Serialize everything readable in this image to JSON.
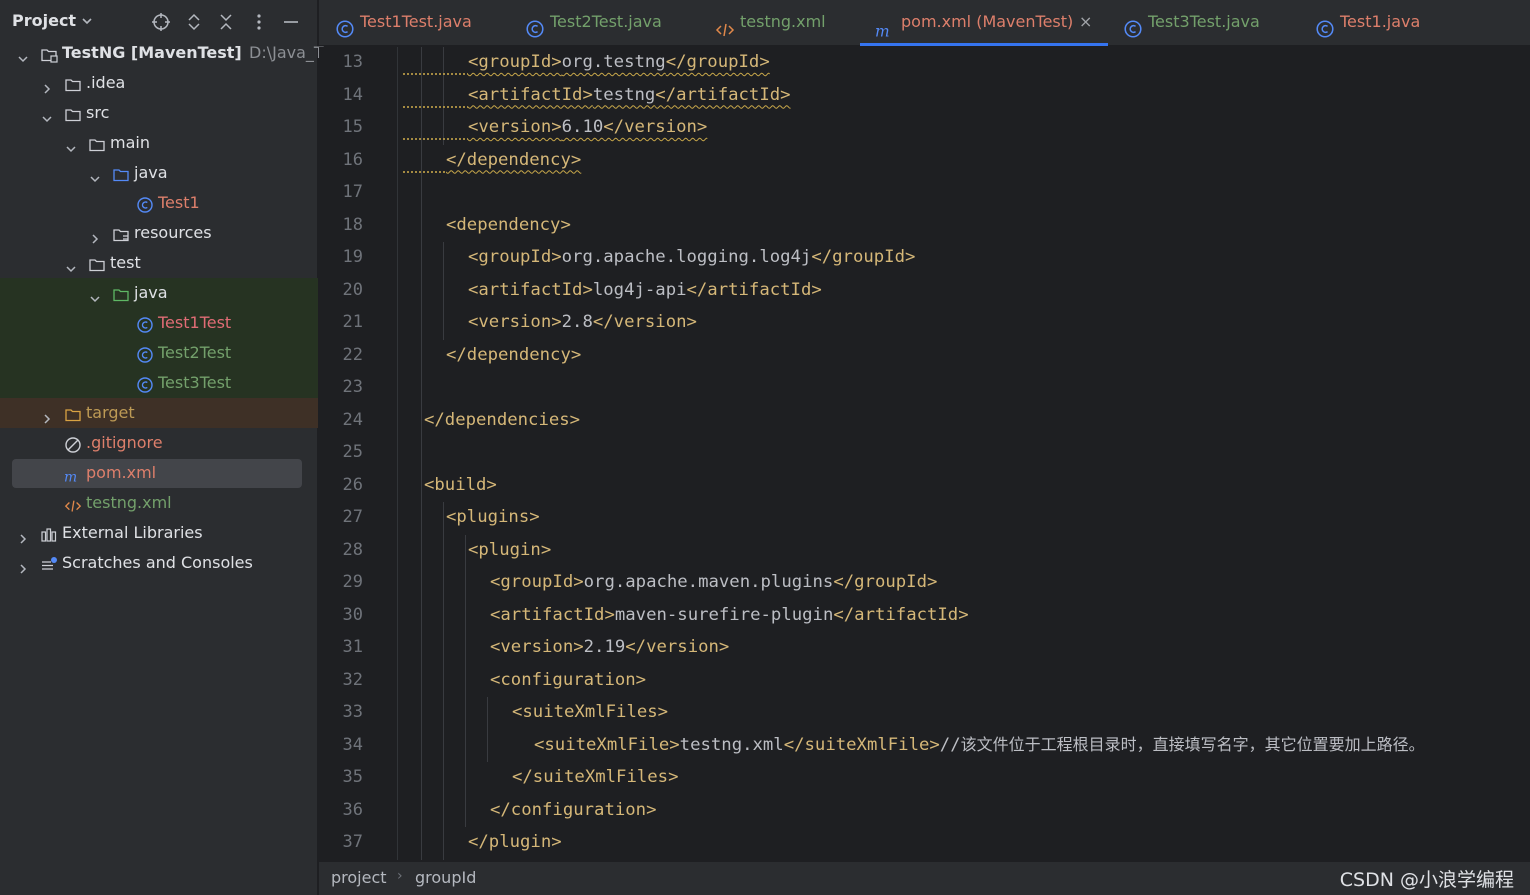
{
  "project_panel": {
    "title": "Project",
    "tree": [
      {
        "label": "TestNG [MavenTest]",
        "extra": "D:\\Java_T",
        "icon": "module-folder-icon",
        "expanded": true
      },
      {
        "label": ".idea",
        "icon": "folder-icon",
        "expanded": false
      },
      {
        "label": "src",
        "icon": "folder-icon",
        "expanded": true
      },
      {
        "label": "main",
        "icon": "folder-icon",
        "expanded": true
      },
      {
        "label": "java",
        "icon": "source-folder-icon",
        "expanded": true
      },
      {
        "label": "Test1",
        "icon": "java-class-icon"
      },
      {
        "label": "resources",
        "icon": "resources-folder-icon",
        "expanded": false
      },
      {
        "label": "test",
        "icon": "folder-icon",
        "expanded": true
      },
      {
        "label": "java",
        "icon": "test-folder-icon",
        "expanded": true
      },
      {
        "label": "Test1Test",
        "icon": "java-class-icon"
      },
      {
        "label": "Test2Test",
        "icon": "java-class-icon"
      },
      {
        "label": "Test3Test",
        "icon": "java-class-icon"
      },
      {
        "label": "target",
        "icon": "excluded-folder-icon",
        "expanded": false
      },
      {
        "label": ".gitignore",
        "icon": "ignore-file-icon"
      },
      {
        "label": "pom.xml",
        "icon": "maven-icon"
      },
      {
        "label": "testng.xml",
        "icon": "xml-icon"
      },
      {
        "label": "External Libraries",
        "icon": "libraries-icon",
        "expanded": false
      },
      {
        "label": "Scratches and Consoles",
        "icon": "scratches-icon",
        "expanded": false
      }
    ]
  },
  "tabs": [
    {
      "label": "Test1Test.java",
      "icon": "java-class-icon"
    },
    {
      "label": "Test2Test.java",
      "icon": "java-class-icon"
    },
    {
      "label": "testng.xml",
      "icon": "xml-icon"
    },
    {
      "label": "pom.xml (MavenTest)",
      "icon": "maven-icon",
      "active": true,
      "close": "×"
    },
    {
      "label": "Test3Test.java",
      "icon": "java-class-icon"
    },
    {
      "label": "Test1.java",
      "icon": "java-class-icon"
    }
  ],
  "editor": {
    "lines": [
      {
        "n": "13",
        "indent": 3,
        "parts": [
          [
            "tag",
            "<groupId>"
          ],
          [
            "txt",
            "org.testng"
          ],
          [
            "tag",
            "</groupId>"
          ]
        ],
        "warn": true
      },
      {
        "n": "14",
        "indent": 3,
        "parts": [
          [
            "tag",
            "<artifactId>"
          ],
          [
            "txt",
            "testng"
          ],
          [
            "tag",
            "</artifactId>"
          ]
        ],
        "warn": true
      },
      {
        "n": "15",
        "indent": 3,
        "parts": [
          [
            "tag",
            "<version>"
          ],
          [
            "txt",
            "6.10"
          ],
          [
            "tag",
            "</version>"
          ]
        ],
        "warn": true
      },
      {
        "n": "16",
        "indent": 2,
        "parts": [
          [
            "tag",
            "</dependency>"
          ]
        ],
        "warn": true
      },
      {
        "n": "17",
        "indent": 0,
        "parts": []
      },
      {
        "n": "18",
        "indent": 2,
        "parts": [
          [
            "tag",
            "<dependency>"
          ]
        ]
      },
      {
        "n": "19",
        "indent": 3,
        "parts": [
          [
            "tag",
            "<groupId>"
          ],
          [
            "txt",
            "org.apache.logging.log4j"
          ],
          [
            "tag",
            "</groupId>"
          ]
        ]
      },
      {
        "n": "20",
        "indent": 3,
        "parts": [
          [
            "tag",
            "<artifactId>"
          ],
          [
            "txt",
            "log4j-api"
          ],
          [
            "tag",
            "</artifactId>"
          ]
        ]
      },
      {
        "n": "21",
        "indent": 3,
        "parts": [
          [
            "tag",
            "<version>"
          ],
          [
            "txt",
            "2.8"
          ],
          [
            "tag",
            "</version>"
          ]
        ]
      },
      {
        "n": "22",
        "indent": 2,
        "parts": [
          [
            "tag",
            "</dependency>"
          ]
        ]
      },
      {
        "n": "23",
        "indent": 0,
        "parts": []
      },
      {
        "n": "24",
        "indent": 1,
        "parts": [
          [
            "tag",
            "</dependencies>"
          ]
        ]
      },
      {
        "n": "25",
        "indent": 0,
        "parts": []
      },
      {
        "n": "26",
        "indent": 1,
        "parts": [
          [
            "tag",
            "<build>"
          ]
        ]
      },
      {
        "n": "27",
        "indent": 2,
        "parts": [
          [
            "tag",
            "<plugins>"
          ]
        ]
      },
      {
        "n": "28",
        "indent": 3,
        "parts": [
          [
            "tag",
            "<plugin>"
          ]
        ]
      },
      {
        "n": "29",
        "indent": 4,
        "parts": [
          [
            "tag",
            "<groupId>"
          ],
          [
            "txt",
            "org.apache.maven.plugins"
          ],
          [
            "tag",
            "</groupId>"
          ]
        ]
      },
      {
        "n": "30",
        "indent": 4,
        "parts": [
          [
            "tag",
            "<artifactId>"
          ],
          [
            "txt",
            "maven-surefire-plugin"
          ],
          [
            "tag",
            "</artifactId>"
          ]
        ]
      },
      {
        "n": "31",
        "indent": 4,
        "parts": [
          [
            "tag",
            "<version>"
          ],
          [
            "txt",
            "2.19"
          ],
          [
            "tag",
            "</version>"
          ]
        ]
      },
      {
        "n": "32",
        "indent": 4,
        "parts": [
          [
            "tag",
            "<configuration>"
          ]
        ]
      },
      {
        "n": "33",
        "indent": 5,
        "parts": [
          [
            "tag",
            "<suiteXmlFiles>"
          ]
        ]
      },
      {
        "n": "34",
        "indent": 6,
        "parts": [
          [
            "tag",
            "<suiteXmlFile>"
          ],
          [
            "txt",
            "testng.xml"
          ],
          [
            "tag",
            "</suiteXmlFile>"
          ],
          [
            "txt",
            "//"
          ],
          [
            "cmt",
            "该文件位于工程根目录时，直接填写名字，其它位置要加上路径。"
          ]
        ]
      },
      {
        "n": "35",
        "indent": 5,
        "parts": [
          [
            "tag",
            "</suiteXmlFiles>"
          ]
        ]
      },
      {
        "n": "36",
        "indent": 4,
        "parts": [
          [
            "tag",
            "</configuration>"
          ]
        ]
      },
      {
        "n": "37",
        "indent": 3,
        "parts": [
          [
            "tag",
            "</plugin>"
          ]
        ]
      }
    ]
  },
  "status_bar": {
    "breadcrumb": [
      "project",
      "groupId"
    ],
    "separator": "›",
    "watermark": "CSDN @小浪学编程"
  },
  "colors": {
    "accent": "#3574f0",
    "tag": "#d5b778",
    "text": "#bcbec4",
    "line_number": "#6f737a"
  }
}
